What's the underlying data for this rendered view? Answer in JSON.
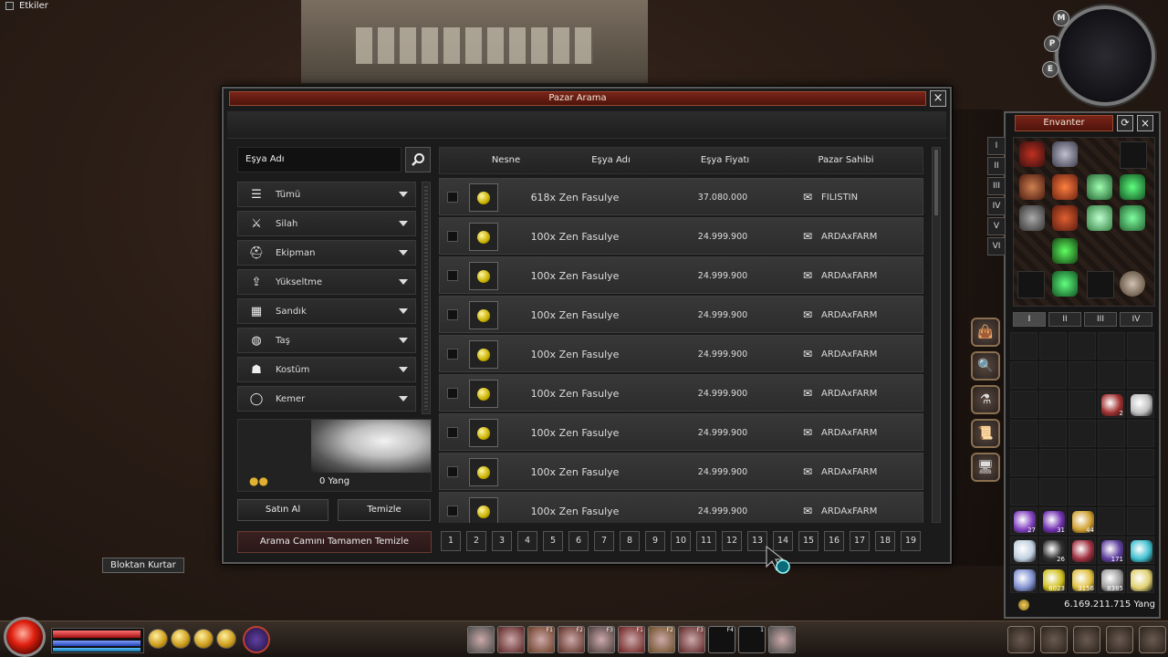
{
  "hud_top": {
    "effects_label": "Etkiler"
  },
  "market": {
    "title": "Pazar Arama",
    "close_symbol": "×",
    "search_placeholder": "Eşya Adı",
    "categories": [
      {
        "label": "Tümü",
        "icon": "list-icon"
      },
      {
        "label": "Silah",
        "icon": "sword-icon"
      },
      {
        "label": "Ekipman",
        "icon": "helmet-icon"
      },
      {
        "label": "Yükseltme",
        "icon": "upgrade-icon"
      },
      {
        "label": "Sandık",
        "icon": "chest-icon"
      },
      {
        "label": "Taş",
        "icon": "stone-icon"
      },
      {
        "label": "Kostüm",
        "icon": "costume-icon"
      },
      {
        "label": "Kemer",
        "icon": "belt-icon"
      }
    ],
    "preview_yang": "0 Yang",
    "buy_label": "Satın Al",
    "clear_label": "Temizle",
    "clear_all_label": "Arama Camını Tamamen Temizle",
    "columns": [
      "Nesne",
      "Eşya Adı",
      "Eşya Fiyatı",
      "Pazar Sahibi"
    ],
    "rows": [
      {
        "name": "618x Zen Fasulye",
        "price": "37.080.000",
        "seller": "FILISTIN"
      },
      {
        "name": "100x Zen Fasulye",
        "price": "24.999.900",
        "seller": "ARDAxFARM"
      },
      {
        "name": "100x Zen Fasulye",
        "price": "24.999.900",
        "seller": "ARDAxFARM"
      },
      {
        "name": "100x Zen Fasulye",
        "price": "24.999.900",
        "seller": "ARDAxFARM"
      },
      {
        "name": "100x Zen Fasulye",
        "price": "24.999.900",
        "seller": "ARDAxFARM"
      },
      {
        "name": "100x Zen Fasulye",
        "price": "24.999.900",
        "seller": "ARDAxFARM"
      },
      {
        "name": "100x Zen Fasulye",
        "price": "24.999.900",
        "seller": "ARDAxFARM"
      },
      {
        "name": "100x Zen Fasulye",
        "price": "24.999.900",
        "seller": "ARDAxFARM"
      },
      {
        "name": "100x Zen Fasulye",
        "price": "24.999.900",
        "seller": "ARDAxFARM"
      }
    ],
    "pages": [
      "1",
      "2",
      "3",
      "4",
      "5",
      "6",
      "7",
      "8",
      "9",
      "10",
      "11",
      "12",
      "13",
      "14",
      "15",
      "16",
      "17",
      "18",
      "19"
    ]
  },
  "minimap": {
    "buttons": [
      "M",
      "P",
      "E"
    ]
  },
  "inventory": {
    "title": "Envanter",
    "refresh_symbol": "⟳",
    "close_symbol": "×",
    "equip_tabs": [
      "I",
      "II",
      "III",
      "IV",
      "V",
      "VI"
    ],
    "page_tabs": [
      "I",
      "II",
      "III",
      "IV"
    ],
    "active_page": 0,
    "yang_total": "6.169.211.715 Yang",
    "item_counts": [
      "2",
      "27",
      "31",
      "44",
      "26",
      "171",
      "6023",
      "3156",
      "8385"
    ]
  },
  "bloktan_label": "Bloktan Kurtar",
  "status": {
    "hp": 0.98,
    "sp": 0.98,
    "stamina": 0.98
  },
  "hotkeys": [
    "F1",
    "F2",
    "F3",
    "F4",
    "F1",
    "F2",
    "F3",
    "F4",
    "1"
  ],
  "colors": {
    "title_red": "#7a2418",
    "gold": "#d0a020"
  }
}
